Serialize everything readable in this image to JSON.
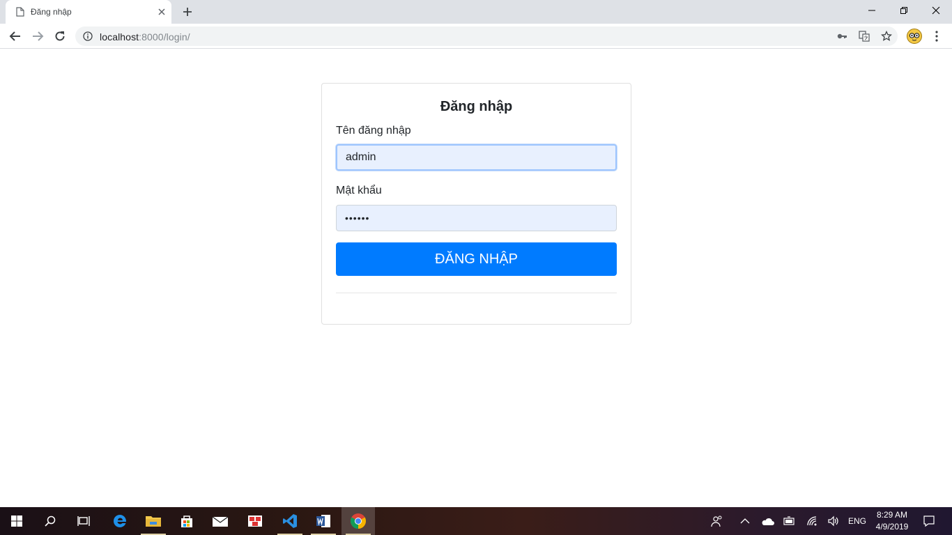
{
  "browser": {
    "tab_title": "Đăng nhập",
    "url_host": "localhost",
    "url_rest": ":8000/login/"
  },
  "login": {
    "heading": "Đăng nhập",
    "username_label": "Tên đăng nhập",
    "username_value": "admin",
    "password_label": "Mật khẩu",
    "password_masked": "••••••",
    "submit_label": "ĐĂNG NHẬP"
  },
  "taskbar": {
    "language": "ENG",
    "time": "8:29 AM",
    "date": "4/9/2019",
    "apps": [
      "start-icon",
      "search-icon",
      "task-view-icon",
      "edge-icon",
      "file-explorer-icon",
      "store-icon",
      "mail-icon",
      "photos-icon",
      "vscode-icon",
      "word-icon",
      "chrome-icon"
    ]
  },
  "colors": {
    "primary": "#007bff",
    "input_bg": "#e8f0fe",
    "tabbar": "#dee1e6"
  }
}
